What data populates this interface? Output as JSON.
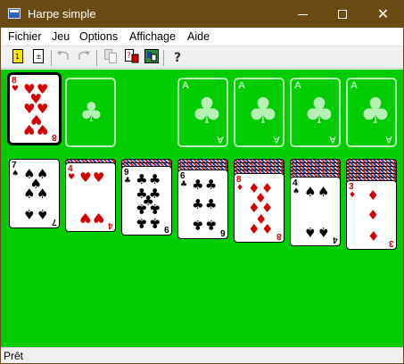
{
  "window": {
    "title": "Harpe simple",
    "title_color": "#6b4a14",
    "felt_color": "#00cc00"
  },
  "menu": [
    "Fichier",
    "Jeu",
    "Options",
    "Affichage",
    "Aide"
  ],
  "toolbar": {
    "buttons": [
      {
        "icon": "new-game-icon",
        "state": "enabled"
      },
      {
        "icon": "deal-icon",
        "state": "enabled"
      },
      {
        "icon": "undo-icon",
        "state": "disabled"
      },
      {
        "icon": "redo-icon",
        "state": "disabled"
      },
      {
        "icon": "copy-icon",
        "state": "disabled"
      },
      {
        "icon": "select-deck-icon",
        "state": "enabled"
      },
      {
        "icon": "statistics-icon",
        "state": "enabled"
      },
      {
        "icon": "help-icon",
        "state": "enabled"
      }
    ],
    "help_glyph": "?"
  },
  "status": {
    "text": "Prêt"
  },
  "stock": {
    "empty": true
  },
  "waste": {
    "rank": "8",
    "suit": "♥",
    "color": "red",
    "pips": 8
  },
  "foundations": [
    {
      "rank": "A",
      "suit": "♣"
    },
    {
      "rank": "A",
      "suit": "♣"
    },
    {
      "rank": "A",
      "suit": "♣"
    },
    {
      "rank": "A",
      "suit": "♣"
    }
  ],
  "tableau": [
    {
      "hidden": 0,
      "rank": "7",
      "suit": "♠",
      "color": "black"
    },
    {
      "hidden": 1,
      "rank": "4",
      "suit": "♥",
      "color": "red"
    },
    {
      "hidden": 2,
      "rank": "9",
      "suit": "♣",
      "color": "black"
    },
    {
      "hidden": 3,
      "rank": "6",
      "suit": "♣",
      "color": "black"
    },
    {
      "hidden": 4,
      "rank": "8",
      "suit": "♦",
      "color": "red"
    },
    {
      "hidden": 5,
      "rank": "4",
      "suit": "♠",
      "color": "black"
    },
    {
      "hidden": 6,
      "rank": "3",
      "suit": "♦",
      "color": "red"
    }
  ]
}
